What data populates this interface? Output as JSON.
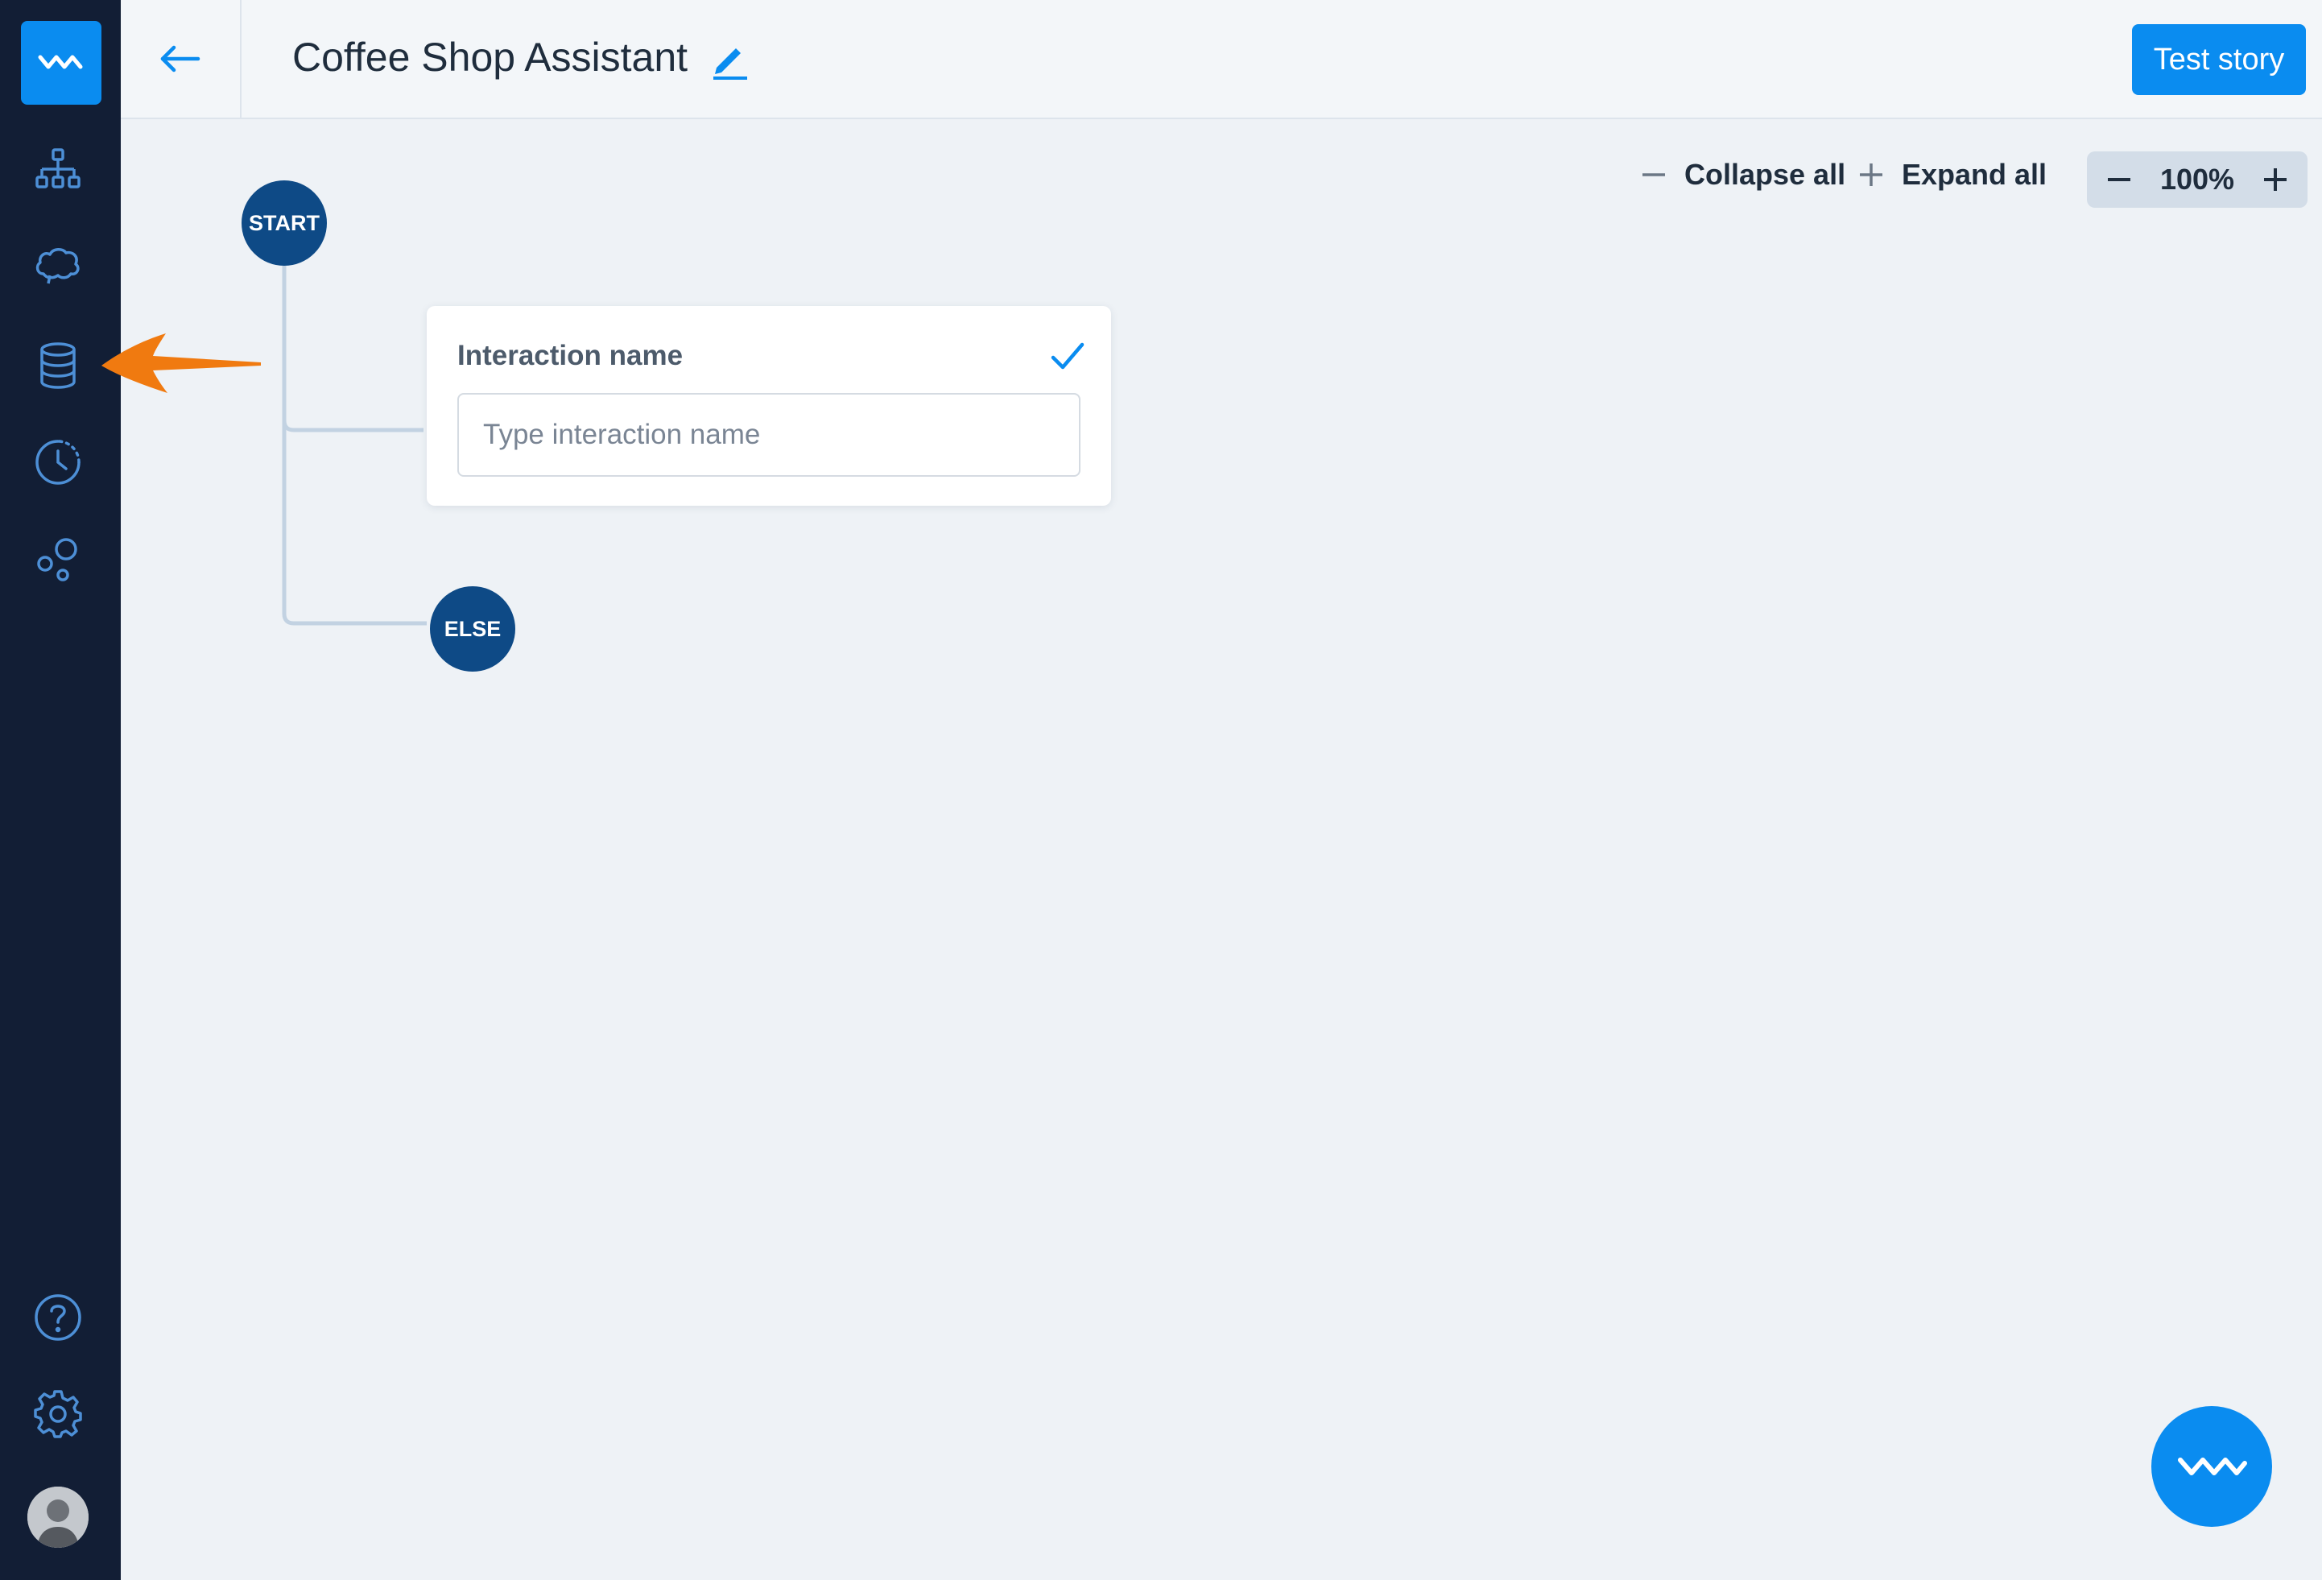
{
  "header": {
    "title": "Coffee Shop Assistant",
    "test_button": "Test story"
  },
  "toolbar": {
    "collapse_all": "Collapse all",
    "expand_all": "Expand all",
    "zoom": "100%"
  },
  "canvas": {
    "start_node": "START",
    "else_node": "ELSE",
    "interaction_card": {
      "label": "Interaction name",
      "input_value": "",
      "input_placeholder": "Type interaction name"
    }
  },
  "sidebar": {
    "items": [
      {
        "icon": "stories-icon"
      },
      {
        "icon": "training-icon"
      },
      {
        "icon": "database-icon"
      },
      {
        "icon": "history-icon"
      },
      {
        "icon": "integrations-icon"
      }
    ],
    "bottom": [
      {
        "icon": "help-icon"
      },
      {
        "icon": "settings-icon"
      },
      {
        "icon": "avatar"
      }
    ]
  },
  "colors": {
    "accent": "#0a8cf0",
    "sidebar_bg": "#121e35",
    "node": "#0e4a86",
    "annotation": "#f07a10"
  }
}
